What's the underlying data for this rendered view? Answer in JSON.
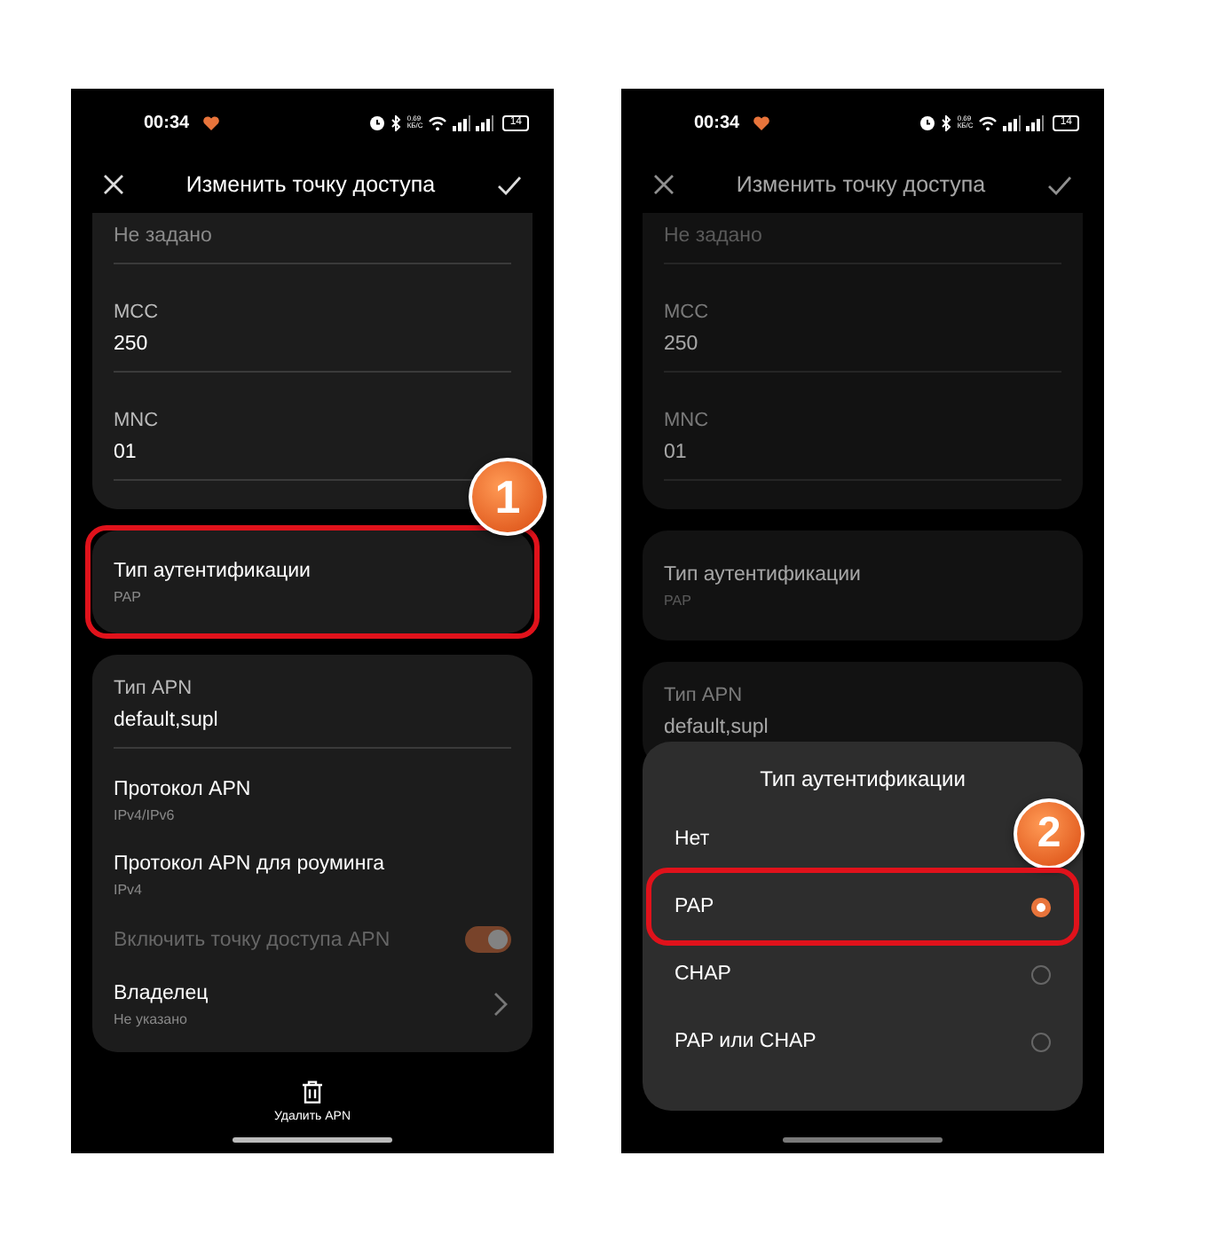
{
  "phones": [
    {
      "status_bar": {
        "time": "00:34",
        "net_speed": [
          "0.69",
          "КБ/С"
        ],
        "battery": "14"
      },
      "header": {
        "title": "Изменить точку доступа"
      },
      "dimmed": false,
      "sections": [
        {
          "fields": [
            {
              "kind": "input",
              "placeholder": "Не задано"
            },
            {
              "kind": "input",
              "label": "MCC",
              "value": "250"
            },
            {
              "kind": "input",
              "label": "MNC",
              "value": "01"
            }
          ]
        },
        {
          "highlighted": true,
          "step": "1",
          "fields": [
            {
              "kind": "value",
              "label": "Тип аутентификации",
              "value": "PAP"
            }
          ]
        },
        {
          "fields": [
            {
              "kind": "input",
              "label": "Тип APN",
              "value": "default,supl"
            },
            {
              "kind": "value",
              "label": "Протокол APN",
              "value": "IPv4/IPv6"
            },
            {
              "kind": "value",
              "label": "Протокол APN для роуминга",
              "value": "IPv4"
            },
            {
              "kind": "switch",
              "label": "Включить точку доступа APN",
              "on": true,
              "disabled": true
            },
            {
              "kind": "link",
              "label": "Владелец",
              "value": "Не указано"
            }
          ]
        }
      ],
      "bottom_bar": {
        "label": "Удалить APN"
      }
    },
    {
      "status_bar": {
        "time": "00:34",
        "net_speed": [
          "0.69",
          "КБ/С"
        ],
        "battery": "14"
      },
      "header": {
        "title": "Изменить точку доступа"
      },
      "dimmed": true,
      "sections": [
        {
          "fields": [
            {
              "kind": "input",
              "placeholder": "Не задано"
            },
            {
              "kind": "input",
              "label": "MCC",
              "value": "250"
            },
            {
              "kind": "input",
              "label": "MNC",
              "value": "01"
            }
          ]
        },
        {
          "highlighted": false,
          "fields": [
            {
              "kind": "value",
              "label": "Тип аутентификации",
              "value": "PAP"
            }
          ]
        },
        {
          "fields": [
            {
              "kind": "input",
              "label": "Тип APN",
              "value": "default,supl"
            }
          ]
        }
      ],
      "dialog": {
        "title": "Тип аутентификации",
        "options": [
          {
            "label": "Нет",
            "highlighted": false
          },
          {
            "label": "PAP",
            "selected": true,
            "highlighted": true,
            "step": "2"
          },
          {
            "label": "CHAP",
            "selected": false,
            "highlighted": false
          },
          {
            "label": "PAP или CHAP",
            "selected": false,
            "highlighted": false
          }
        ]
      }
    }
  ]
}
